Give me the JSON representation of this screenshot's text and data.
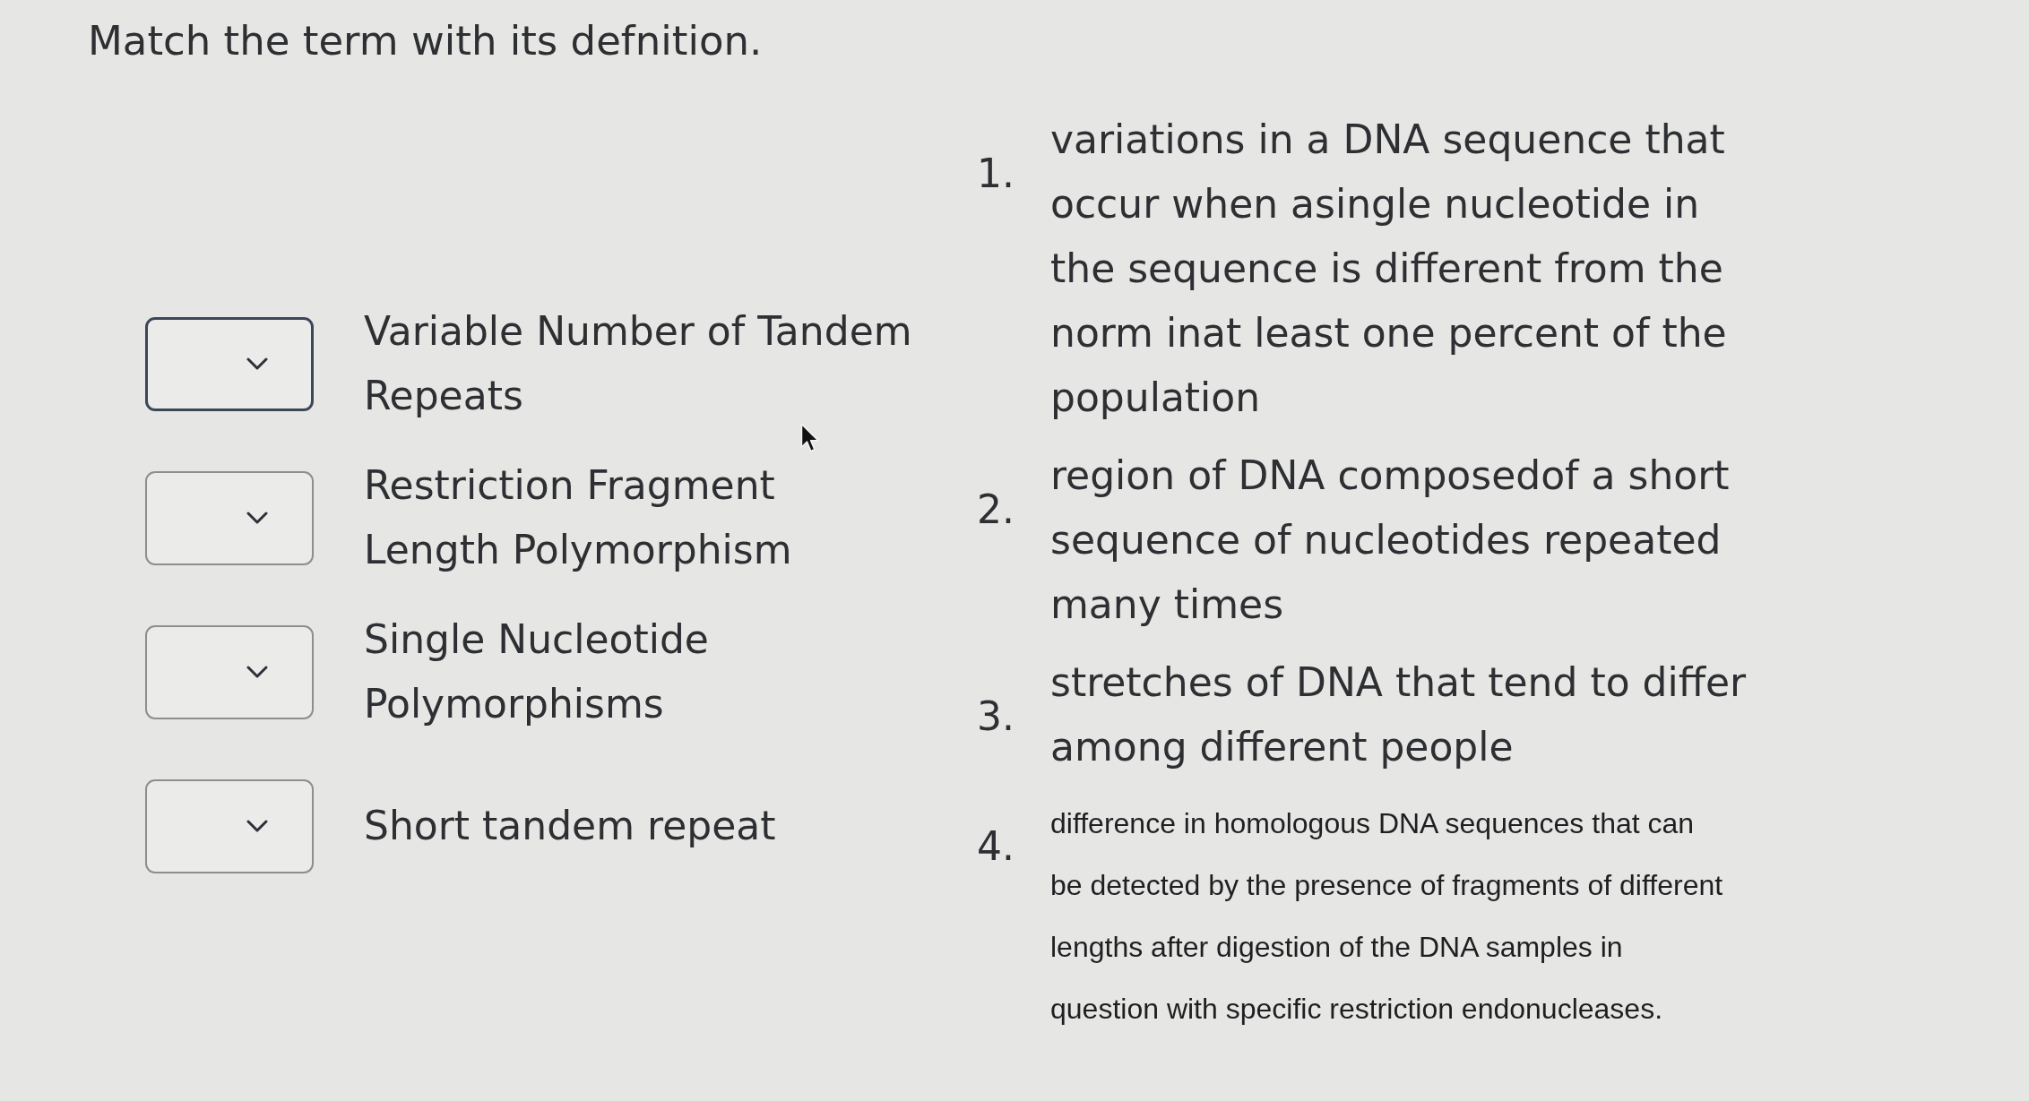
{
  "title": "Match the term with its defnition.",
  "terms": [
    {
      "label": "Variable Number of Tandem Repeats",
      "focused": true
    },
    {
      "label": "Restriction Fragment Length Polymorphism",
      "focused": false
    },
    {
      "label": "Single Nucleotide Polymorphisms",
      "focused": false
    },
    {
      "label": "Short tandem repeat",
      "focused": false
    }
  ],
  "definitions": [
    {
      "number": "1.",
      "kind": "regular",
      "text": "variations in a DNA sequence that occur when asingle nucleotide in the sequence is different from the norm inat least one percent of the population"
    },
    {
      "number": "2.",
      "kind": "regular",
      "text": "region of DNA composedof a short sequence of nucleotides repeated many times"
    },
    {
      "number": "3.",
      "kind": "regular",
      "text": "stretches of DNA that tend to differ among different people"
    },
    {
      "number": "4.",
      "kind": "small",
      "text": "difference in homologous DNA sequences that can be detected by the presence of fragments of different lengths after digestion of the DNA samples in question with specific restriction endonucleases."
    }
  ]
}
